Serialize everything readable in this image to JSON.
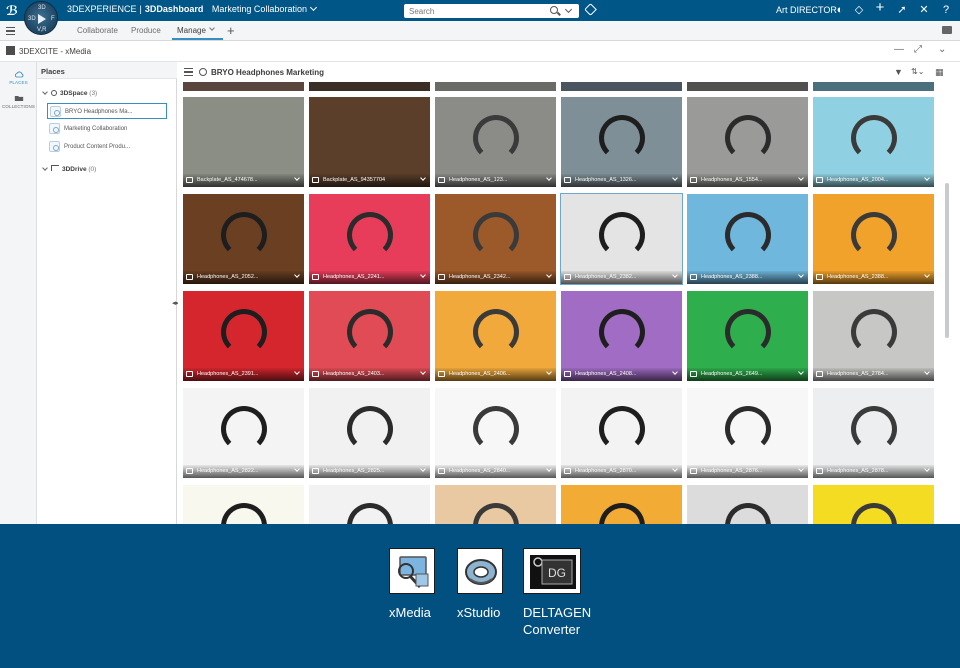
{
  "topbar": {
    "compass_labels": {
      "top": "3D",
      "left": "3D",
      "right": "F",
      "bottom": "V,R"
    },
    "brand_main": "3DEXPERIENCE",
    "brand_app": "3DDashboard",
    "brand_separator": "|",
    "context": "Marketing Collaboration",
    "search_placeholder": "Search",
    "user": "Art DIRECTOR",
    "icons": [
      "tag-icon",
      "contrast-icon",
      "chat-bubble-icon",
      "add-icon",
      "share-icon",
      "tools-icon",
      "help-icon"
    ]
  },
  "tabs": {
    "items": [
      {
        "label": "Collaborate",
        "active": false
      },
      {
        "label": "Produce",
        "active": false
      },
      {
        "label": "Manage",
        "active": true
      }
    ],
    "add_label": "+"
  },
  "widget": {
    "title": "3DEXCITE - xMedia"
  },
  "rail": {
    "items": [
      {
        "label": "PLACES",
        "active": true
      },
      {
        "label": "COLLECTIONS",
        "active": false
      }
    ]
  },
  "places": {
    "title": "Places",
    "space_label": "3DSpace",
    "space_count": "(3)",
    "space_items": [
      "BRYO Headphones Ma...",
      "Marketing Collaboration",
      "Product Content Produ..."
    ],
    "drive_label": "3DDrive",
    "drive_count": "(0)"
  },
  "content": {
    "title": "BRYO Headphones Marketing",
    "tiles": [
      {
        "name": "Backplate_AS_474678...",
        "bg": "#8a8e84"
      },
      {
        "name": "Backplate_AS_94357704",
        "bg": "#5b3f2a"
      },
      {
        "name": "Headphones_AS_123...",
        "bg": "#8b8b88"
      },
      {
        "name": "Headphones_AS_1326...",
        "bg": "#7f8f97"
      },
      {
        "name": "Headphones_AS_1554...",
        "bg": "#9a9a98"
      },
      {
        "name": "Headphones_AS_2004...",
        "bg": "#8fd1e2"
      },
      {
        "name": "Headphones_AS_2052...",
        "bg": "#6b3f22"
      },
      {
        "name": "Headphones_AS_2241...",
        "bg": "#e83d5a"
      },
      {
        "name": "Headphones_AS_2342...",
        "bg": "#9c5a2a"
      },
      {
        "name": "Headphones_AS_2382...",
        "bg": "#e4e4e4"
      },
      {
        "name": "Headphones_AS_2388...",
        "bg": "#70b7dd"
      },
      {
        "name": "Headphones_AS_2388...",
        "bg": "#f1a22a"
      },
      {
        "name": "Headphones_AS_2391...",
        "bg": "#d5262e"
      },
      {
        "name": "Headphones_AS_2403...",
        "bg": "#e14b55"
      },
      {
        "name": "Headphones_AS_2406...",
        "bg": "#f0a93a"
      },
      {
        "name": "Headphones_AS_2408...",
        "bg": "#a06cc4"
      },
      {
        "name": "Headphones_AS_2649...",
        "bg": "#2eae4c"
      },
      {
        "name": "Headphones_AS_2784...",
        "bg": "#c7c7c5"
      },
      {
        "name": "Headphones_AS_2822...",
        "bg": "#f4f4f4"
      },
      {
        "name": "Headphones_AS_2825...",
        "bg": "#f1f1f1"
      },
      {
        "name": "Headphones_AS_2840...",
        "bg": "#f6f7f6"
      },
      {
        "name": "Headphones_AS_2870...",
        "bg": "#f3f3f3"
      },
      {
        "name": "Headphones_AS_2876...",
        "bg": "#f7f7f8"
      },
      {
        "name": "Headphones_AS_2878...",
        "bg": "#eceeef"
      },
      {
        "name": "",
        "bg": "#f8f8ee"
      },
      {
        "name": "",
        "bg": "#f2f2f2"
      },
      {
        "name": "",
        "bg": "#e9c9a2"
      },
      {
        "name": "",
        "bg": "#f2ab35"
      },
      {
        "name": "",
        "bg": "#dcdcdc"
      },
      {
        "name": "",
        "bg": "#f3dc22"
      }
    ]
  },
  "launcher": {
    "apps": [
      {
        "label": "xMedia"
      },
      {
        "label": "xStudio"
      },
      {
        "label": "DELTAGEN Converter",
        "line1": "DELTAGEN",
        "line2": "Converter",
        "badge": "DG"
      }
    ]
  }
}
